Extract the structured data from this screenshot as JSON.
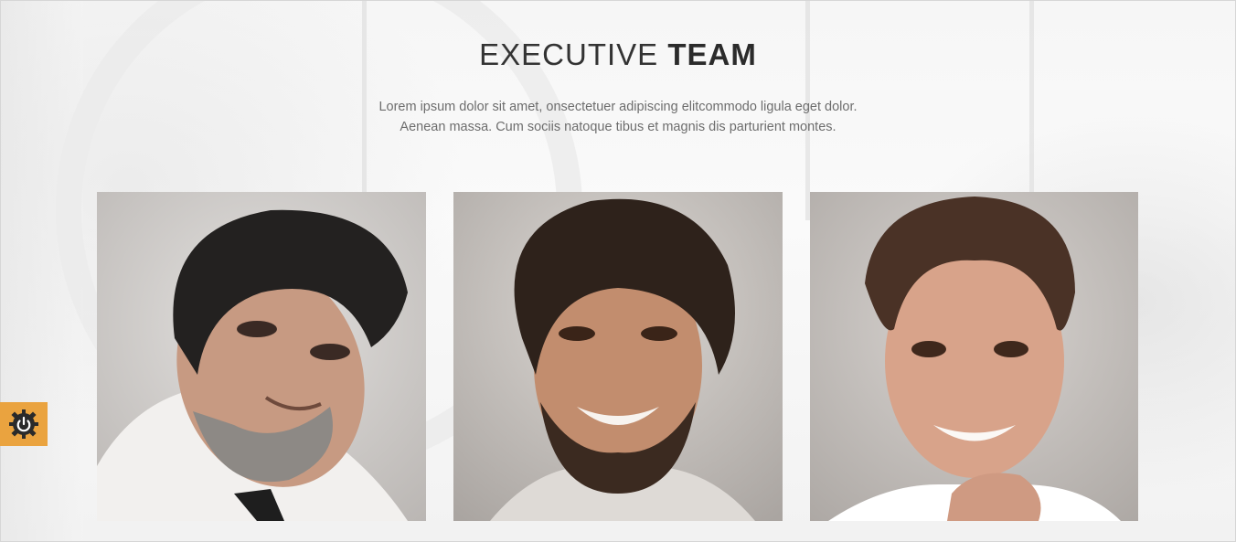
{
  "section": {
    "title_light": "EXECUTIVE",
    "title_bold": "TEAM",
    "description_lines": [
      "Lorem ipsum dolor sit amet, onsectetuer adipiscing elitcommodo ligula eget dolor.",
      "Aenean massa. Cum sociis natoque tibus et magnis dis parturient montes."
    ]
  },
  "team_members": [
    {
      "photo": "portrait-bearded-man-dark-hair"
    },
    {
      "photo": "portrait-smiling-man-curly-hair"
    },
    {
      "photo": "portrait-smiling-young-man"
    }
  ],
  "widget": {
    "icon": "power-gear-icon",
    "color": "#eaa33f"
  },
  "colors": {
    "title": "#333333",
    "text": "#6d6d6d",
    "accent": "#eaa33f"
  }
}
